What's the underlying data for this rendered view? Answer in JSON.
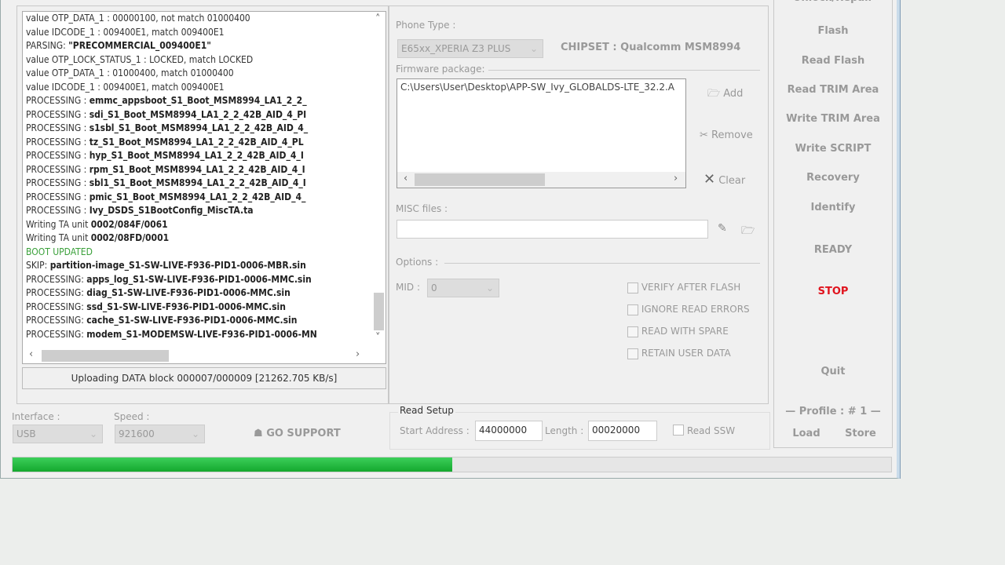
{
  "log": {
    "lines": [
      {
        "pre": "value OTP_DATA_1 :  00000100, not match 01000400",
        "bold": ""
      },
      {
        "pre": "value IDCODE_1 : 009400E1, match 009400E1",
        "bold": ""
      },
      {
        "pre": "PARSING: ",
        "bold": "\"PRECOMMERCIAL_009400E1\""
      },
      {
        "pre": "value OTP_LOCK_STATUS_1 : LOCKED, match LOCKED",
        "bold": ""
      },
      {
        "pre": "value OTP_DATA_1 : 01000400, match 01000400",
        "bold": ""
      },
      {
        "pre": "value IDCODE_1 : 009400E1, match 009400E1",
        "bold": ""
      },
      {
        "pre": "PROCESSING : ",
        "bold": "emmc_appsboot_S1_Boot_MSM8994_LA1_2_2_"
      },
      {
        "pre": "PROCESSING : ",
        "bold": "sdi_S1_Boot_MSM8994_LA1_2_2_42B_AID_4_PI"
      },
      {
        "pre": "PROCESSING : ",
        "bold": "s1sbl_S1_Boot_MSM8994_LA1_2_2_42B_AID_4_"
      },
      {
        "pre": "PROCESSING : ",
        "bold": "tz_S1_Boot_MSM8994_LA1_2_2_42B_AID_4_PL"
      },
      {
        "pre": "PROCESSING : ",
        "bold": "hyp_S1_Boot_MSM8994_LA1_2_2_42B_AID_4_I"
      },
      {
        "pre": "PROCESSING : ",
        "bold": "rpm_S1_Boot_MSM8994_LA1_2_2_42B_AID_4_I"
      },
      {
        "pre": "PROCESSING : ",
        "bold": "sbl1_S1_Boot_MSM8994_LA1_2_2_42B_AID_4_I"
      },
      {
        "pre": "PROCESSING : ",
        "bold": "pmic_S1_Boot_MSM8994_LA1_2_2_42B_AID_4_"
      },
      {
        "pre": "PROCESSING : ",
        "bold": "Ivy_DSDS_S1BootConfig_MiscTA.ta"
      },
      {
        "pre": "Writing TA unit ",
        "bold": "0002/084F/0061"
      },
      {
        "pre": "Writing TA unit ",
        "bold": "0002/08FD/0001"
      },
      {
        "pre": "BOOT UPDATED",
        "bold": "",
        "color": "#3aa03a"
      },
      {
        "pre": "SKIP: ",
        "bold": "partition-image_S1-SW-LIVE-F936-PID1-0006-MBR.sin"
      },
      {
        "pre": "PROCESSING: ",
        "bold": "apps_log_S1-SW-LIVE-F936-PID1-0006-MMC.sin"
      },
      {
        "pre": "PROCESSING: ",
        "bold": "diag_S1-SW-LIVE-F936-PID1-0006-MMC.sin"
      },
      {
        "pre": "PROCESSING: ",
        "bold": "ssd_S1-SW-LIVE-F936-PID1-0006-MMC.sin"
      },
      {
        "pre": "PROCESSING: ",
        "bold": "cache_S1-SW-LIVE-F936-PID1-0006-MMC.sin"
      },
      {
        "pre": "PROCESSING: ",
        "bold": "modem_S1-MODEMSW-LIVE-F936-PID1-0006-MN"
      }
    ]
  },
  "status_text": "Uploading DATA block 000007/000009 [21262.705 KB/s]",
  "phone": {
    "label": "Phone Type :",
    "value": "E65xx_XPERIA Z3 PLUS",
    "chipset": "CHIPSET : Qualcomm MSM8994"
  },
  "firmware": {
    "label": "Firmware package:",
    "path": "C:\\Users\\User\\Desktop\\APP-SW_Ivy_GLOBALDS-LTE_32.2.A",
    "add": "Add",
    "remove": "Remove",
    "clear": "Clear"
  },
  "misc": {
    "label": "MISC files :",
    "value": ""
  },
  "options": {
    "label": "Options :",
    "mid_label": "MID :",
    "mid_value": "0",
    "checks": [
      {
        "label": "VERIFY AFTER FLASH",
        "checked": false
      },
      {
        "label": "IGNORE READ ERRORS",
        "checked": false
      },
      {
        "label": "READ WITH SPARE",
        "checked": false
      },
      {
        "label": "RETAIN USER DATA",
        "checked": false
      }
    ]
  },
  "side": {
    "buttons": [
      "Unlock/Repair",
      "Flash",
      "Read Flash",
      "Read TRIM Area",
      "Write TRIM Area",
      "Write SCRIPT",
      "Recovery",
      "Identify"
    ],
    "ready": "READY",
    "stop": "STOP",
    "quit": "Quit",
    "profile": "Profile : # 1",
    "load": "Load",
    "store": "Store",
    "stop_color": "#e0141e"
  },
  "bottom": {
    "interface_label": "Interface :",
    "interface": "USB",
    "speed_label": "Speed :",
    "speed": "921600",
    "support": "GO SUPPORT",
    "read_setup": {
      "title": "Read Setup",
      "start_label": "Start Address :",
      "start": "44000000",
      "length_label": "Length :",
      "length": "00020000",
      "ssw_label": "Read SSW",
      "ssw_checked": false
    }
  },
  "progress": {
    "percent": 50,
    "color": "#1db53a"
  }
}
